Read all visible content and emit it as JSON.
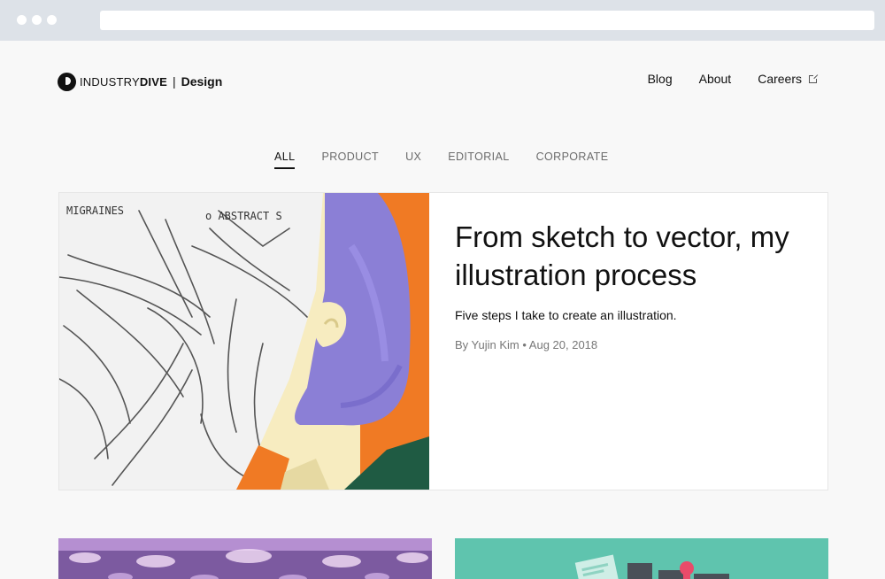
{
  "brand": {
    "name_light": "INDUSTRY",
    "name_bold": "DIVE",
    "separator": "|",
    "section": "Design"
  },
  "nav": {
    "items": [
      "Blog",
      "About",
      "Careers"
    ]
  },
  "filters": {
    "tabs": [
      "ALL",
      "PRODUCT",
      "UX",
      "EDITORIAL",
      "CORPORATE"
    ],
    "active": "ALL"
  },
  "featured": {
    "title": "From sketch to vector, my illustration process",
    "subtitle": "Five steps I take to create an illustration.",
    "meta": "By Yujin Kim • Aug 20, 2018",
    "sketch_notes": [
      "MIGRAINES",
      "o ABSTRACT S"
    ]
  },
  "colors": {
    "accent_orange": "#f07a24",
    "accent_purple": "#8b7fd6",
    "skin": "#f7ecc0",
    "green": "#1f5b43",
    "teal": "#5fc4ae"
  }
}
